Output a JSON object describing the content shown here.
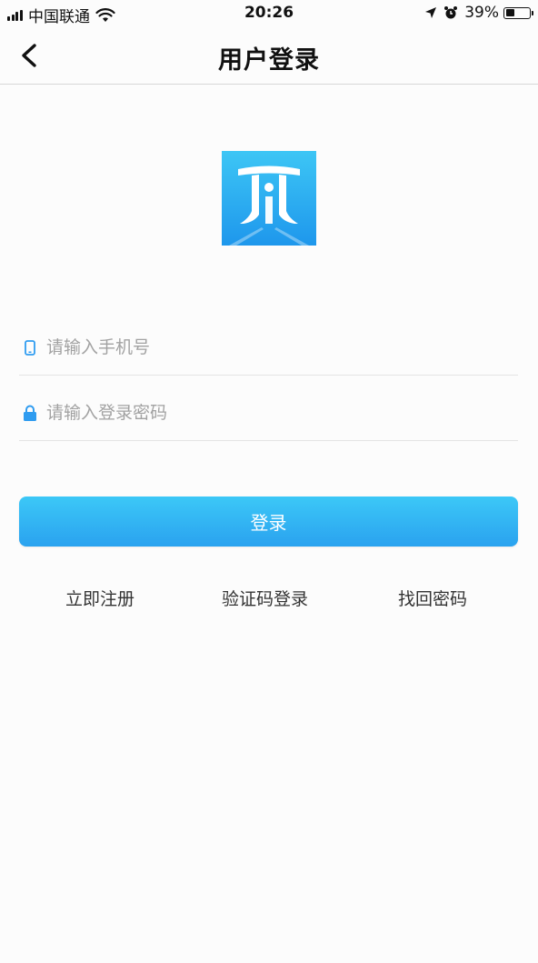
{
  "status_bar": {
    "carrier": "中国联通",
    "time": "20:26",
    "battery": "39%",
    "battery_level": 0.39,
    "icons": [
      "signal-icon",
      "wifi-icon",
      "location-icon",
      "alarm-icon",
      "battery-icon"
    ]
  },
  "nav": {
    "title": "用户登录",
    "back_icon": "chevron-left-icon"
  },
  "logo": {
    "icon": "app-logo",
    "colors": {
      "top": "#3dc6f5",
      "bottom": "#1e97ec"
    }
  },
  "form": {
    "phone_placeholder": "请输入手机号",
    "phone_icon": "phone-icon",
    "password_placeholder": "请输入登录密码",
    "password_icon": "lock-icon"
  },
  "login_button": {
    "label": "登录",
    "color": "#2faaf0"
  },
  "links": {
    "register": "立即注册",
    "code_login": "验证码登录",
    "forgot_password": "找回密码"
  }
}
